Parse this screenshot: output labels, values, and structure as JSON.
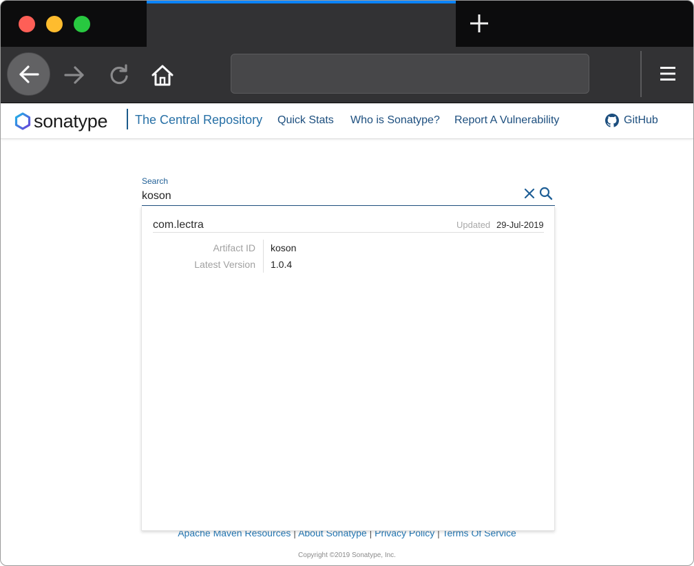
{
  "browser": {
    "tab_title": "",
    "url": ""
  },
  "site": {
    "logo_text": "sonatype",
    "title": "The Central Repository",
    "nav": [
      "Quick Stats",
      "Who is Sonatype?",
      "Report A Vulnerability"
    ],
    "github_label": "GitHub"
  },
  "search": {
    "label": "Search",
    "value": "koson"
  },
  "result": {
    "group_id": "com.lectra",
    "updated_label": "Updated",
    "updated_date": "29-Jul-2019",
    "fields": [
      {
        "label": "Artifact ID",
        "value": "koson"
      },
      {
        "label": "Latest Version",
        "value": "1.0.4"
      }
    ]
  },
  "footer": {
    "links": [
      "Apache Maven Resources",
      "About Sonatype",
      "Privacy Policy",
      "Terms Of Service"
    ],
    "separator": " | ",
    "copyright": "Copyright ©2019 Sonatype, Inc."
  },
  "colors": {
    "tab_accent": "#0a84ff",
    "brand_blue": "#2770a6",
    "link_color": "#1c4e7e"
  }
}
